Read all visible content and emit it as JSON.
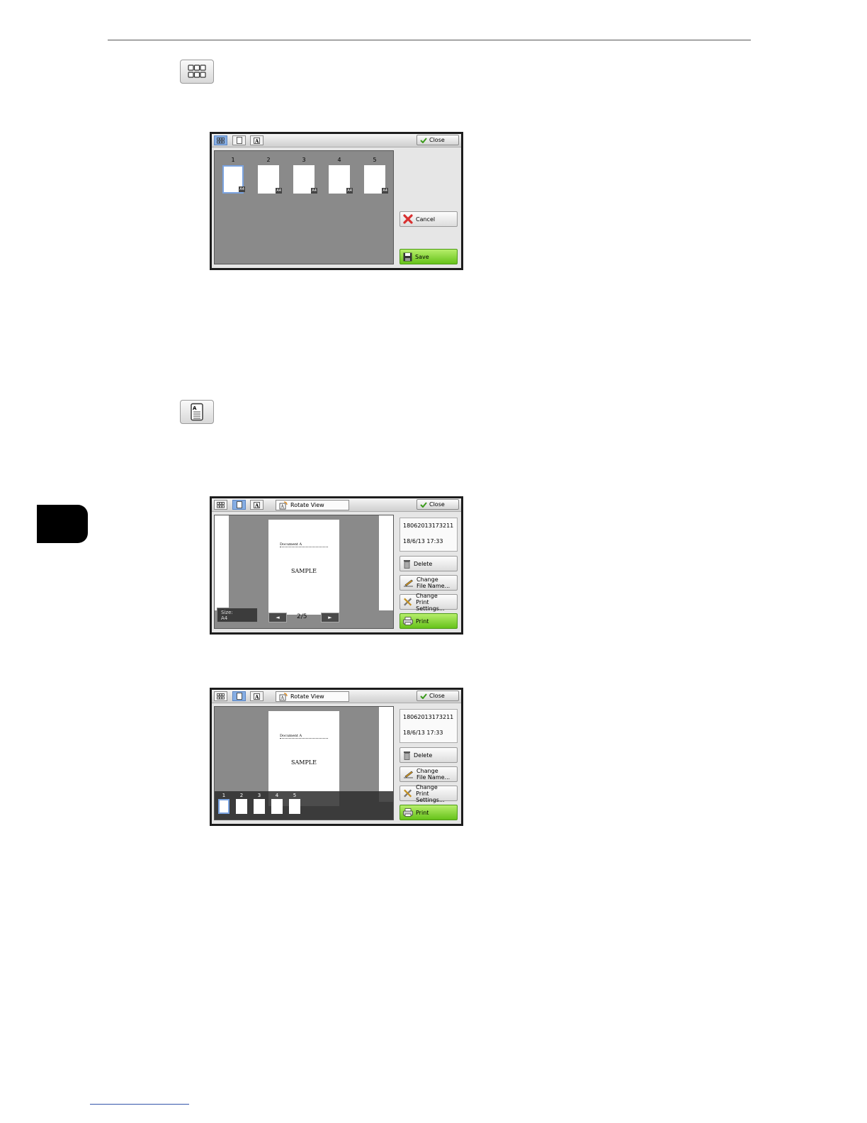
{
  "thumbnail_panel": {
    "close_label": "Close",
    "pages": [
      {
        "number": "1",
        "size": "A4"
      },
      {
        "number": "2",
        "size": "A4"
      },
      {
        "number": "3",
        "size": "A4"
      },
      {
        "number": "4",
        "size": "A4"
      },
      {
        "number": "5",
        "size": "A4"
      }
    ],
    "cancel_label": "Cancel",
    "save_label": "Save"
  },
  "page_panel": {
    "close_label": "Close",
    "rotate_label": "Rotate View",
    "file_name": "18062013173211",
    "file_date": "18/6/13 17:33",
    "delete_label": "Delete",
    "change_file_line1": "Change",
    "change_file_line2": "File Name...",
    "change_print_line1": "Change",
    "change_print_line2": "Print Settings...",
    "print_label": "Print",
    "document_label": "Document A",
    "sample_text": "SAMPLE",
    "size_label": "Size:",
    "size_value": "A4",
    "page_indicator": "2/5",
    "prev_arrow": "◄",
    "next_arrow": "►"
  },
  "strip_panel": {
    "close_label": "Close",
    "rotate_label": "Rotate View",
    "file_name": "18062013173211",
    "file_date": "18/6/13 17:33",
    "delete_label": "Delete",
    "change_file_line1": "Change",
    "change_file_line2": "File Name...",
    "change_print_line1": "Change",
    "change_print_line2": "Print Settings...",
    "print_label": "Print",
    "document_label": "Document A",
    "sample_text": "SAMPLE",
    "pages": [
      "1",
      "2",
      "3",
      "4",
      "5"
    ]
  },
  "colors": {
    "accent_blue": "#86aee4",
    "print_green": "#66c21a",
    "cancel_red": "#d83030"
  }
}
